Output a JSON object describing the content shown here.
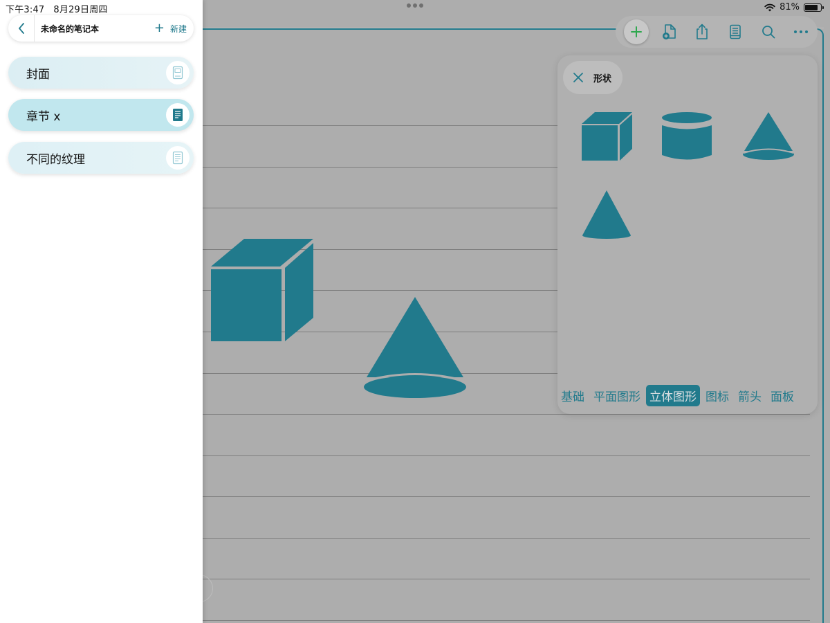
{
  "status_bar": {
    "time": "下午3:47",
    "date": "8月29日周四",
    "battery": "81%",
    "battery_level": 0.81,
    "wifi_icon": "wifi-icon",
    "battery_icon": "battery-icon"
  },
  "sidebar": {
    "notebook_title": "未命名的笔记本",
    "new_label": "新建",
    "new_icon": "plus-icon",
    "back_icon": "chevron-left-icon",
    "items": [
      {
        "label": "封面",
        "icon": "cover-page-icon",
        "selected": false
      },
      {
        "label": "章节 x",
        "icon": "document-icon",
        "selected": true
      },
      {
        "label": "不同的纹理",
        "icon": "document-icon",
        "selected": false
      }
    ]
  },
  "toolbar": {
    "buttons": [
      {
        "name": "add",
        "icon": "plus-icon",
        "color": "#2fa84f"
      },
      {
        "name": "add-page",
        "icon": "add-page-icon"
      },
      {
        "name": "share",
        "icon": "share-icon"
      },
      {
        "name": "pages",
        "icon": "notebook-icon"
      },
      {
        "name": "search",
        "icon": "search-icon"
      },
      {
        "name": "more",
        "icon": "more-icon"
      }
    ]
  },
  "shape_panel": {
    "title": "形状",
    "close_icon": "close-icon",
    "shapes": [
      "cube-icon",
      "cylinder-icon",
      "cone-icon",
      "cone-icon"
    ],
    "tabs": [
      {
        "label": "基础",
        "active": false
      },
      {
        "label": "平面图形",
        "active": false
      },
      {
        "label": "立体图形",
        "active": true
      },
      {
        "label": "图标",
        "active": false
      },
      {
        "label": "箭头",
        "active": false
      },
      {
        "label": "面板",
        "active": false
      }
    ]
  },
  "canvas": {
    "shapes": [
      "cube",
      "cone"
    ]
  },
  "colors": {
    "accent": "#217a8c",
    "shape_fill": "#217a8c",
    "dim_background": "#adadad",
    "selected_item": "#c1e7ee"
  }
}
